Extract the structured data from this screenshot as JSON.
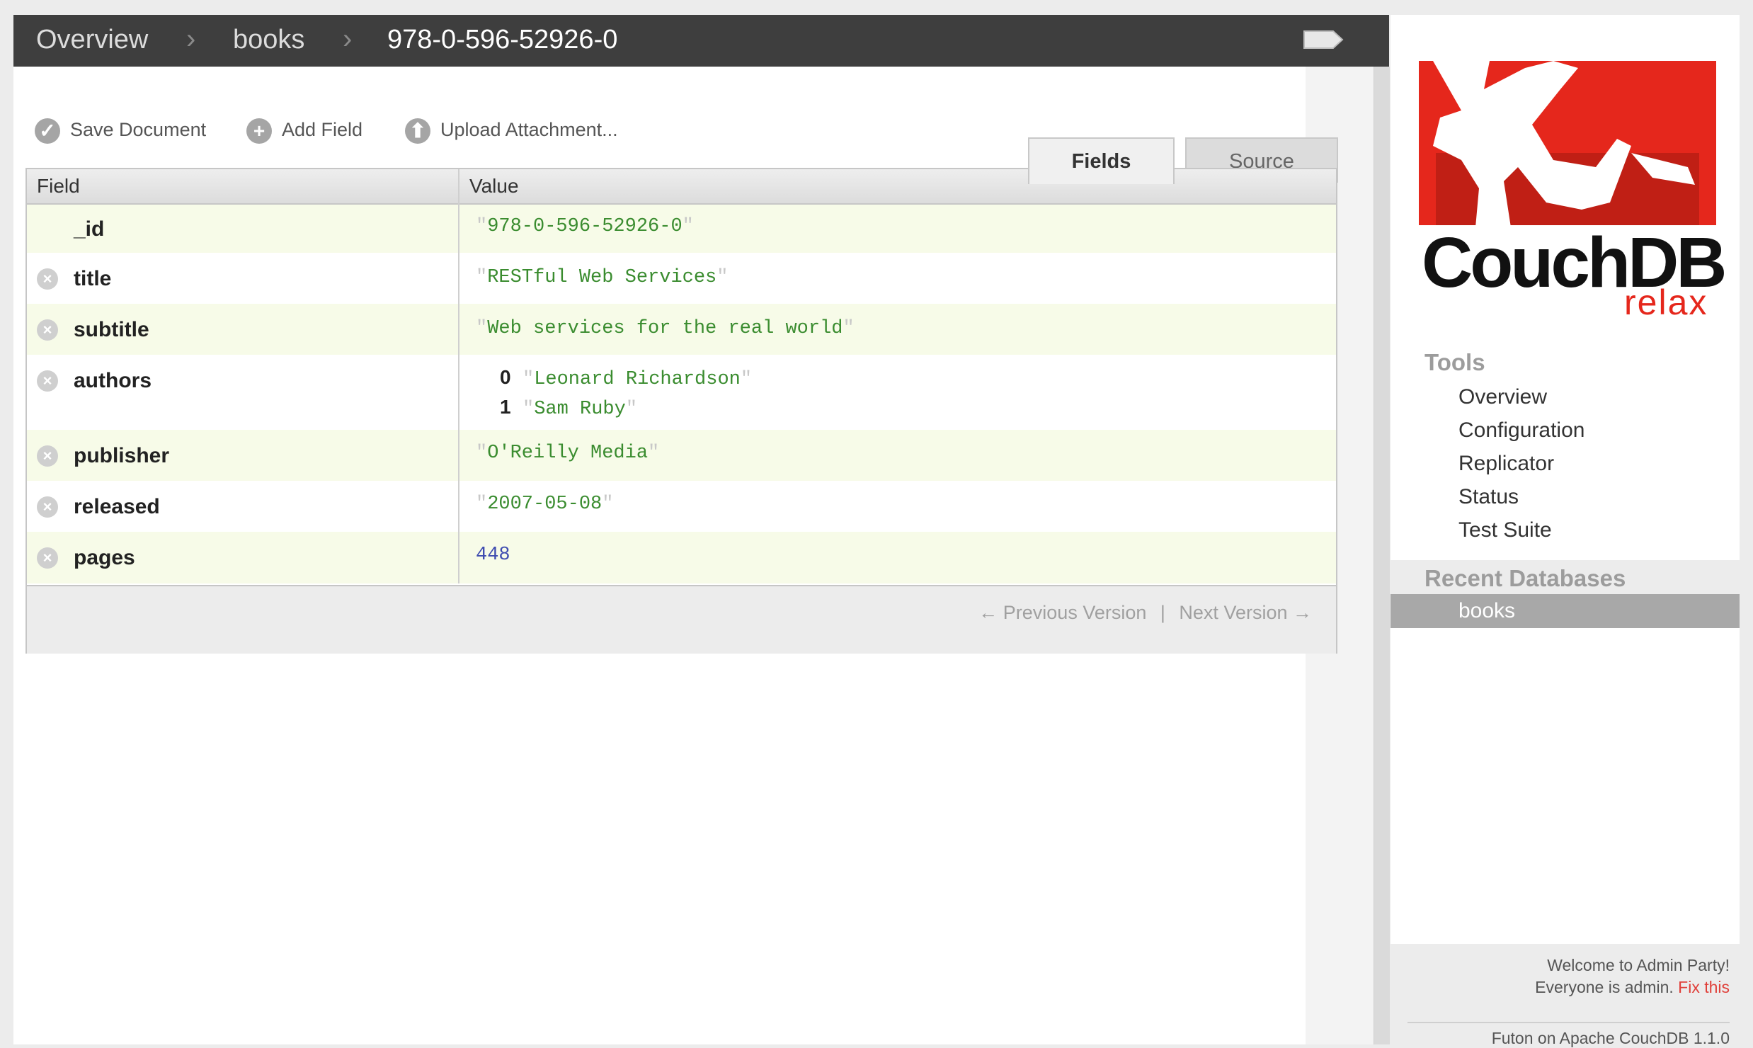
{
  "breadcrumb": {
    "items": [
      "Overview",
      "books",
      "978-0-596-52926-0"
    ],
    "separator": "›"
  },
  "toolbar": {
    "save_label": "Save Document",
    "add_field_label": "Add Field",
    "upload_label": "Upload Attachment..."
  },
  "tabs": {
    "fields": "Fields",
    "source": "Source",
    "active": "Fields"
  },
  "table": {
    "headers": {
      "field": "Field",
      "value": "Value"
    },
    "rows": [
      {
        "key": "_id",
        "value": "978-0-596-52926-0",
        "type": "string",
        "deletable": false
      },
      {
        "key": "title",
        "value": "RESTful Web Services",
        "type": "string",
        "deletable": true
      },
      {
        "key": "subtitle",
        "value": "Web services for the real world",
        "type": "string",
        "deletable": true
      },
      {
        "key": "authors",
        "type": "array",
        "deletable": true,
        "items": [
          {
            "index": "0",
            "value": "Leonard Richardson"
          },
          {
            "index": "1",
            "value": "Sam Ruby"
          }
        ]
      },
      {
        "key": "publisher",
        "value": "O'Reilly Media",
        "type": "string",
        "deletable": true
      },
      {
        "key": "released",
        "value": "2007-05-08",
        "type": "string",
        "deletable": true
      },
      {
        "key": "pages",
        "value": "448",
        "type": "number",
        "deletable": true
      }
    ],
    "pager": {
      "previous": "← Previous Version",
      "divider": "|",
      "next": "Next Version →"
    }
  },
  "sidebar": {
    "logo_text": "CouchDB",
    "logo_tagline": "relax",
    "tools_heading": "Tools",
    "tools": [
      "Overview",
      "Configuration",
      "Replicator",
      "Status",
      "Test Suite"
    ],
    "recent_heading": "Recent Databases",
    "recent": [
      "books"
    ],
    "footer": {
      "welcome": "Welcome to Admin Party!",
      "admin_note": "Everyone is admin.",
      "fix_link": "Fix this",
      "version": "Futon on Apache CouchDB 1.1.0"
    }
  },
  "colors": {
    "topbar": "#3e3e3e",
    "string_value": "#3a8c2f",
    "number_value": "#3f4cb0",
    "brand_red": "#e5271c",
    "link_red": "#e0403a"
  },
  "icons": [
    "tag-icon",
    "check-circle-icon",
    "plus-circle-icon",
    "upload-circle-icon",
    "remove-circle-icon",
    "collapse-chevron-icon",
    "couchdb-logo"
  ]
}
